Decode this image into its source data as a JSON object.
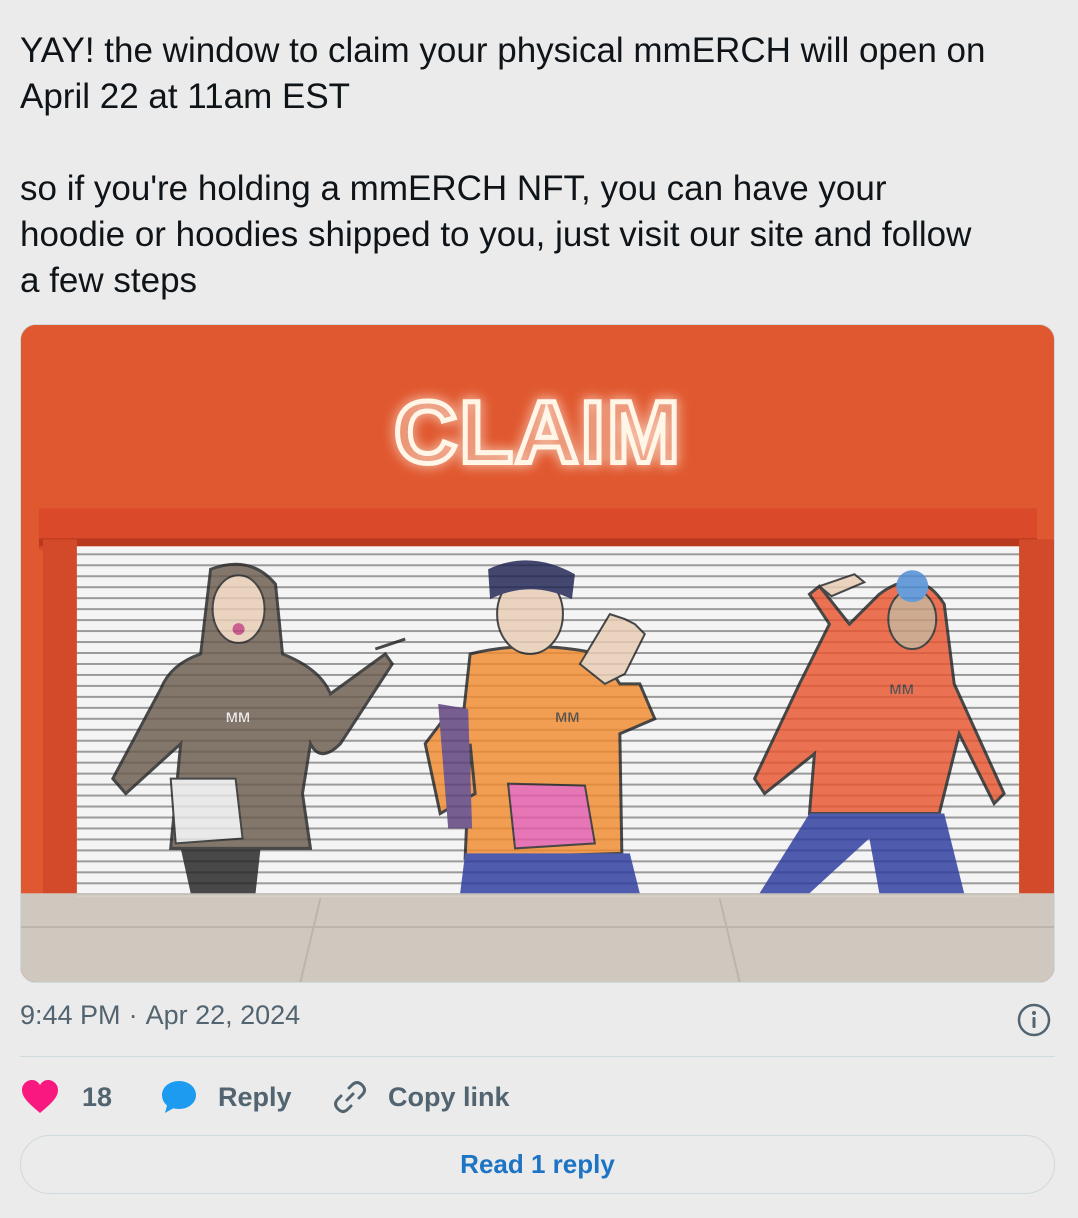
{
  "tweet": {
    "text_lines_p1": [
      "YAY! the window to claim your physical mmERCH will open on",
      "April 22 at 11am EST"
    ],
    "text_lines_p2": [
      "so if you're holding a mmERCH NFT, you can have your",
      "hoodie or hoodies shipped to you, just visit our site and follow",
      "a few steps"
    ],
    "media": {
      "sign_text": "CLAIM",
      "shirt_logo": "ᴍᴍ",
      "colors": {
        "wall": "#e0582f",
        "frame": "#d9492a",
        "shutter": "#f4f4f4",
        "sidewalk": "#cfc8bf"
      }
    },
    "time": "9:44 PM",
    "separator": "·",
    "date": "Apr 22, 2024"
  },
  "actions": {
    "like_count": "18",
    "like_icon": "heart-icon",
    "reply_label": "Reply",
    "reply_icon": "speech-bubble-icon",
    "copy_label": "Copy link",
    "copy_icon": "link-icon"
  },
  "read_replies_label": "Read 1 reply",
  "colors": {
    "heart": "#f91880",
    "reply_bubble": "#1d9bf0",
    "link_blue": "#1d74c4",
    "muted": "#536471"
  }
}
